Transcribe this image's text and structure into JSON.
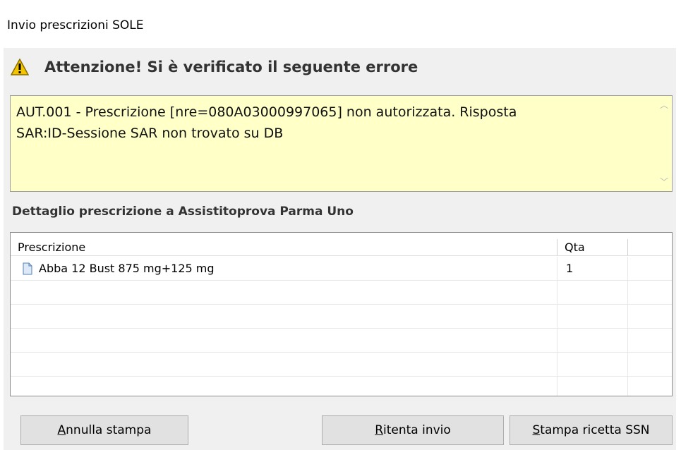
{
  "window": {
    "title": "Invio prescrizioni SOLE"
  },
  "header": {
    "icon": "warning-icon",
    "title": "Attenzione! Si è verificato il seguente errore"
  },
  "error": {
    "line1": "AUT.001 - Prescrizione [nre=080A03000997065] non autorizzata.  Risposta",
    "line2": "SAR:ID-Sessione SAR non trovato su DB",
    "background": "#ffffc8"
  },
  "detail": {
    "label": "Dettaglio prescrizione a Assistitoprova Parma Uno"
  },
  "table": {
    "columns": [
      "Prescrizione",
      "Qta",
      ""
    ],
    "rows": [
      {
        "icon": "document-icon",
        "prescrizione": "Abba 12 Bust 875 mg+125 mg",
        "qta": "1"
      }
    ]
  },
  "buttons": {
    "cancel": {
      "accel": "A",
      "rest": "nnulla stampa"
    },
    "retry": {
      "accel": "R",
      "rest": "itenta invio"
    },
    "print": {
      "accel": "S",
      "rest": "tampa ricetta SSN"
    }
  }
}
